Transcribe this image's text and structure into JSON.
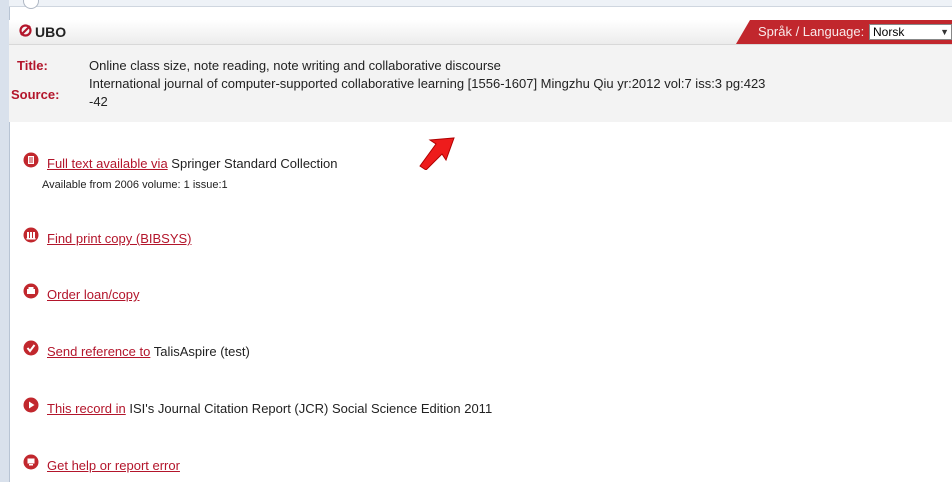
{
  "header": {
    "logo_text": "UBO",
    "language_label": "Språk / Language:",
    "language_value": "Norsk"
  },
  "record": {
    "title_label": "Title:",
    "title_value": "Online class size, note reading, note writing and collaborative discourse",
    "source_label": "Source:",
    "source_line1": "International journal of computer-supported collaborative learning [1556-1607] Mingzhu Qiu yr:2012 vol:7 iss:3 pg:423",
    "source_line2": "-42"
  },
  "services": {
    "fulltext": {
      "link": "Full text available via",
      "suffix": "Springer Standard Collection",
      "note": "Available from 2006 volume: 1 issue:1"
    },
    "print": {
      "link": "Find print copy (BIBSYS)"
    },
    "loan": {
      "link": "Order loan/copy"
    },
    "reference": {
      "link": "Send reference to",
      "suffix": "TalisAspire (test)"
    },
    "jcr": {
      "link": "This record in",
      "suffix": "ISI's Journal Citation Report (JCR) Social Science Edition 2011"
    },
    "help": {
      "link": "Get help or report error"
    }
  },
  "colors": {
    "brand_red": "#b3152b",
    "tab_red": "#c1272d"
  },
  "icons": [
    "document-icon",
    "library-icon",
    "printer-icon",
    "send-icon",
    "play-icon",
    "help-screen-icon",
    "red-arrow-icon"
  ]
}
